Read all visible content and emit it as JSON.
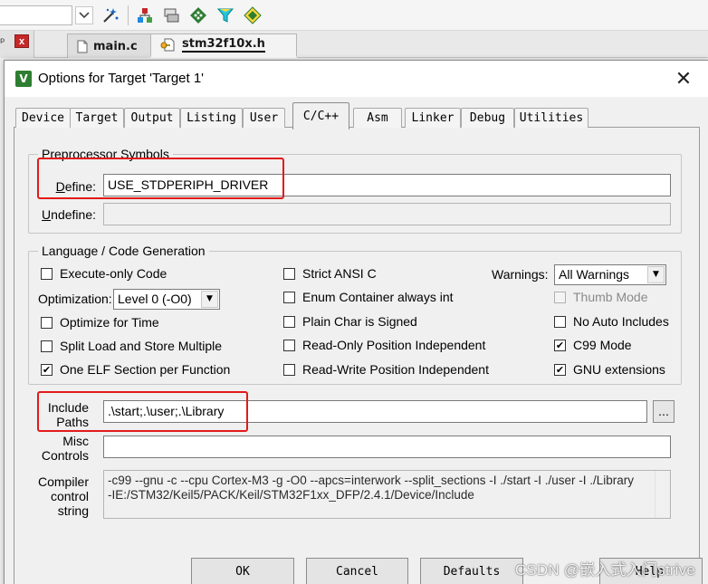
{
  "ide": {
    "toolbar_icons": [
      "dropdown-arrow-icon",
      "magic-wand-icon",
      "manage-components-icon",
      "stack-icon",
      "green-diamond-icon",
      "funnel-icon",
      "pack-installer-icon"
    ],
    "file_tabs": [
      {
        "label": "main.c",
        "icon": "file-icon"
      },
      {
        "label": "stm32f10x.h",
        "icon": "header-file-icon"
      }
    ],
    "panel_pin": "p",
    "panel_close": "x"
  },
  "dialog": {
    "title": "Options for Target 'Target 1'",
    "close_glyph": "✕",
    "tabs": [
      "Device",
      "Target",
      "Output",
      "Listing",
      "User",
      "C/C++",
      "Asm",
      "Linker",
      "Debug",
      "Utilities"
    ],
    "active_tab": "C/C++"
  },
  "preprocessor": {
    "group_title": "Preprocessor Symbols",
    "define_label_pre": "",
    "define_label_ul": "D",
    "define_label_post": "efine:",
    "define_value": "USE_STDPERIPH_DRIVER",
    "undefine_label_pre": "",
    "undefine_label_ul": "U",
    "undefine_label_post": "ndefine:",
    "undefine_value": ""
  },
  "codegen": {
    "group_title": "Language / Code Generation",
    "execute_only": {
      "label": "Execute-only Code",
      "checked": false
    },
    "optimization_label": "Optimization:",
    "optimization_value": "Level 0 (-O0)",
    "optimize_time": {
      "label": "Optimize for Time",
      "checked": false
    },
    "split_load": {
      "label": "Split Load and Store Multiple",
      "checked": false
    },
    "one_elf": {
      "label": "One ELF Section per Function",
      "checked": true
    },
    "strict_ansi": {
      "label": "Strict ANSI C",
      "checked": false
    },
    "enum_container": {
      "label": "Enum Container always int",
      "checked": false
    },
    "plain_char": {
      "label": "Plain Char is Signed",
      "checked": false
    },
    "ro_pi": {
      "label": "Read-Only Position Independent",
      "checked": false
    },
    "rw_pi": {
      "label": "Read-Write Position Independent",
      "checked": false
    },
    "warnings_label": "Warnings:",
    "warnings_value": "All Warnings",
    "thumb_mode": {
      "label": "Thumb Mode",
      "checked": false,
      "disabled": true
    },
    "no_auto_includes": {
      "label": "No Auto Includes",
      "checked": false
    },
    "c99_mode": {
      "label": "C99 Mode",
      "checked": true
    },
    "gnu_extensions": {
      "label": "GNU extensions",
      "checked": true
    }
  },
  "paths": {
    "include_label_1": "Include",
    "include_label_2": "Paths",
    "include_value": ".\\start;.\\user;.\\Library",
    "browse_glyph": "…",
    "misc_label_1": "Misc",
    "misc_label_2": "Controls",
    "misc_value": "",
    "compiler_label_1": "Compiler",
    "compiler_label_2": "control",
    "compiler_label_3": "string",
    "compiler_line_1": "-c99 --gnu -c --cpu Cortex-M3 -g -O0 --apcs=interwork --split_sections -I ./start -I ./user -I ./Library",
    "compiler_line_2": "-IE:/STM32/Keil5/PACK/Keil/STM32F1xx_DFP/2.4.1/Device/Include"
  },
  "buttons": {
    "ok": "OK",
    "cancel": "Cancel",
    "defaults": "Defaults",
    "help": "Help"
  },
  "watermark": "CSDN @嵌入式入门strive",
  "colors": {
    "highlight": "#e21a1a",
    "dialog_bg": "#f0f0f0"
  }
}
